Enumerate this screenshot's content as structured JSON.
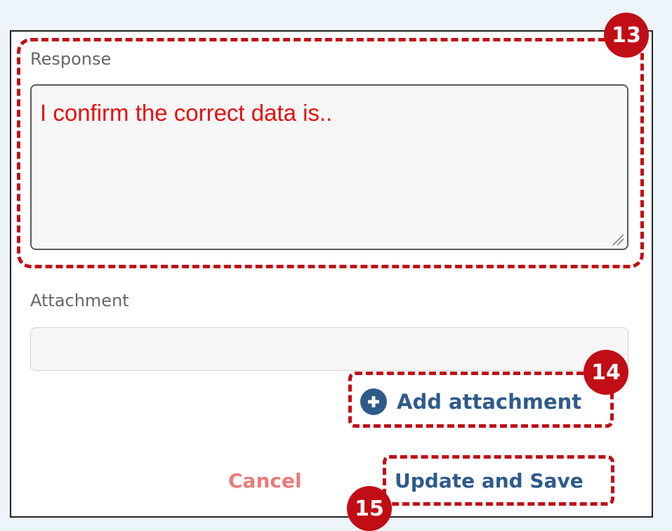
{
  "form": {
    "response_label": "Response",
    "response_value": "I confirm the correct data is..",
    "attachment_label": "Attachment",
    "attachment_value": "",
    "add_attachment_label": "Add attachment",
    "cancel_label": "Cancel",
    "update_label": "Update and Save"
  },
  "callouts": [
    {
      "number": "13"
    },
    {
      "number": "14"
    },
    {
      "number": "15"
    }
  ],
  "colors": {
    "background": "#edf5fb",
    "callout": "#c10d16",
    "primary": "#2f5b8a",
    "cancel": "#ea7b7b",
    "response_text": "#e60e0e"
  },
  "icons": {
    "add_attachment": "plus-circle-icon",
    "textarea_resize": "resize-grip-icon"
  }
}
